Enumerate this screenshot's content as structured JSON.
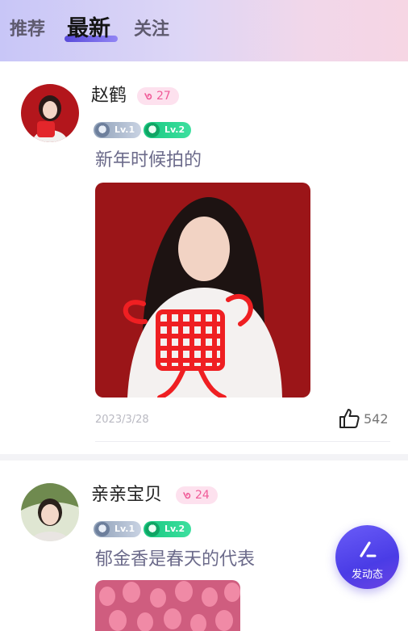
{
  "tabs": [
    {
      "label": "推荐",
      "active": false
    },
    {
      "label": "最新",
      "active": true
    },
    {
      "label": "关注",
      "active": false
    }
  ],
  "posts": [
    {
      "username": "赵鹤",
      "badge_count": "27",
      "levels": [
        "Lv.1",
        "Lv.2"
      ],
      "text": "新年时候拍的",
      "date": "2023/3/28",
      "likes": "542"
    },
    {
      "username": "亲亲宝贝",
      "badge_count": "24",
      "levels": [
        "Lv.1",
        "Lv.2"
      ],
      "text": "郁金香是春天的代表"
    }
  ],
  "fab": {
    "label": "发动态"
  },
  "colors": {
    "accent": "#5b4cf0",
    "badge_pink": "#f05b98",
    "level_green": "#1fcf88",
    "text_muted": "#6b6a8a"
  }
}
